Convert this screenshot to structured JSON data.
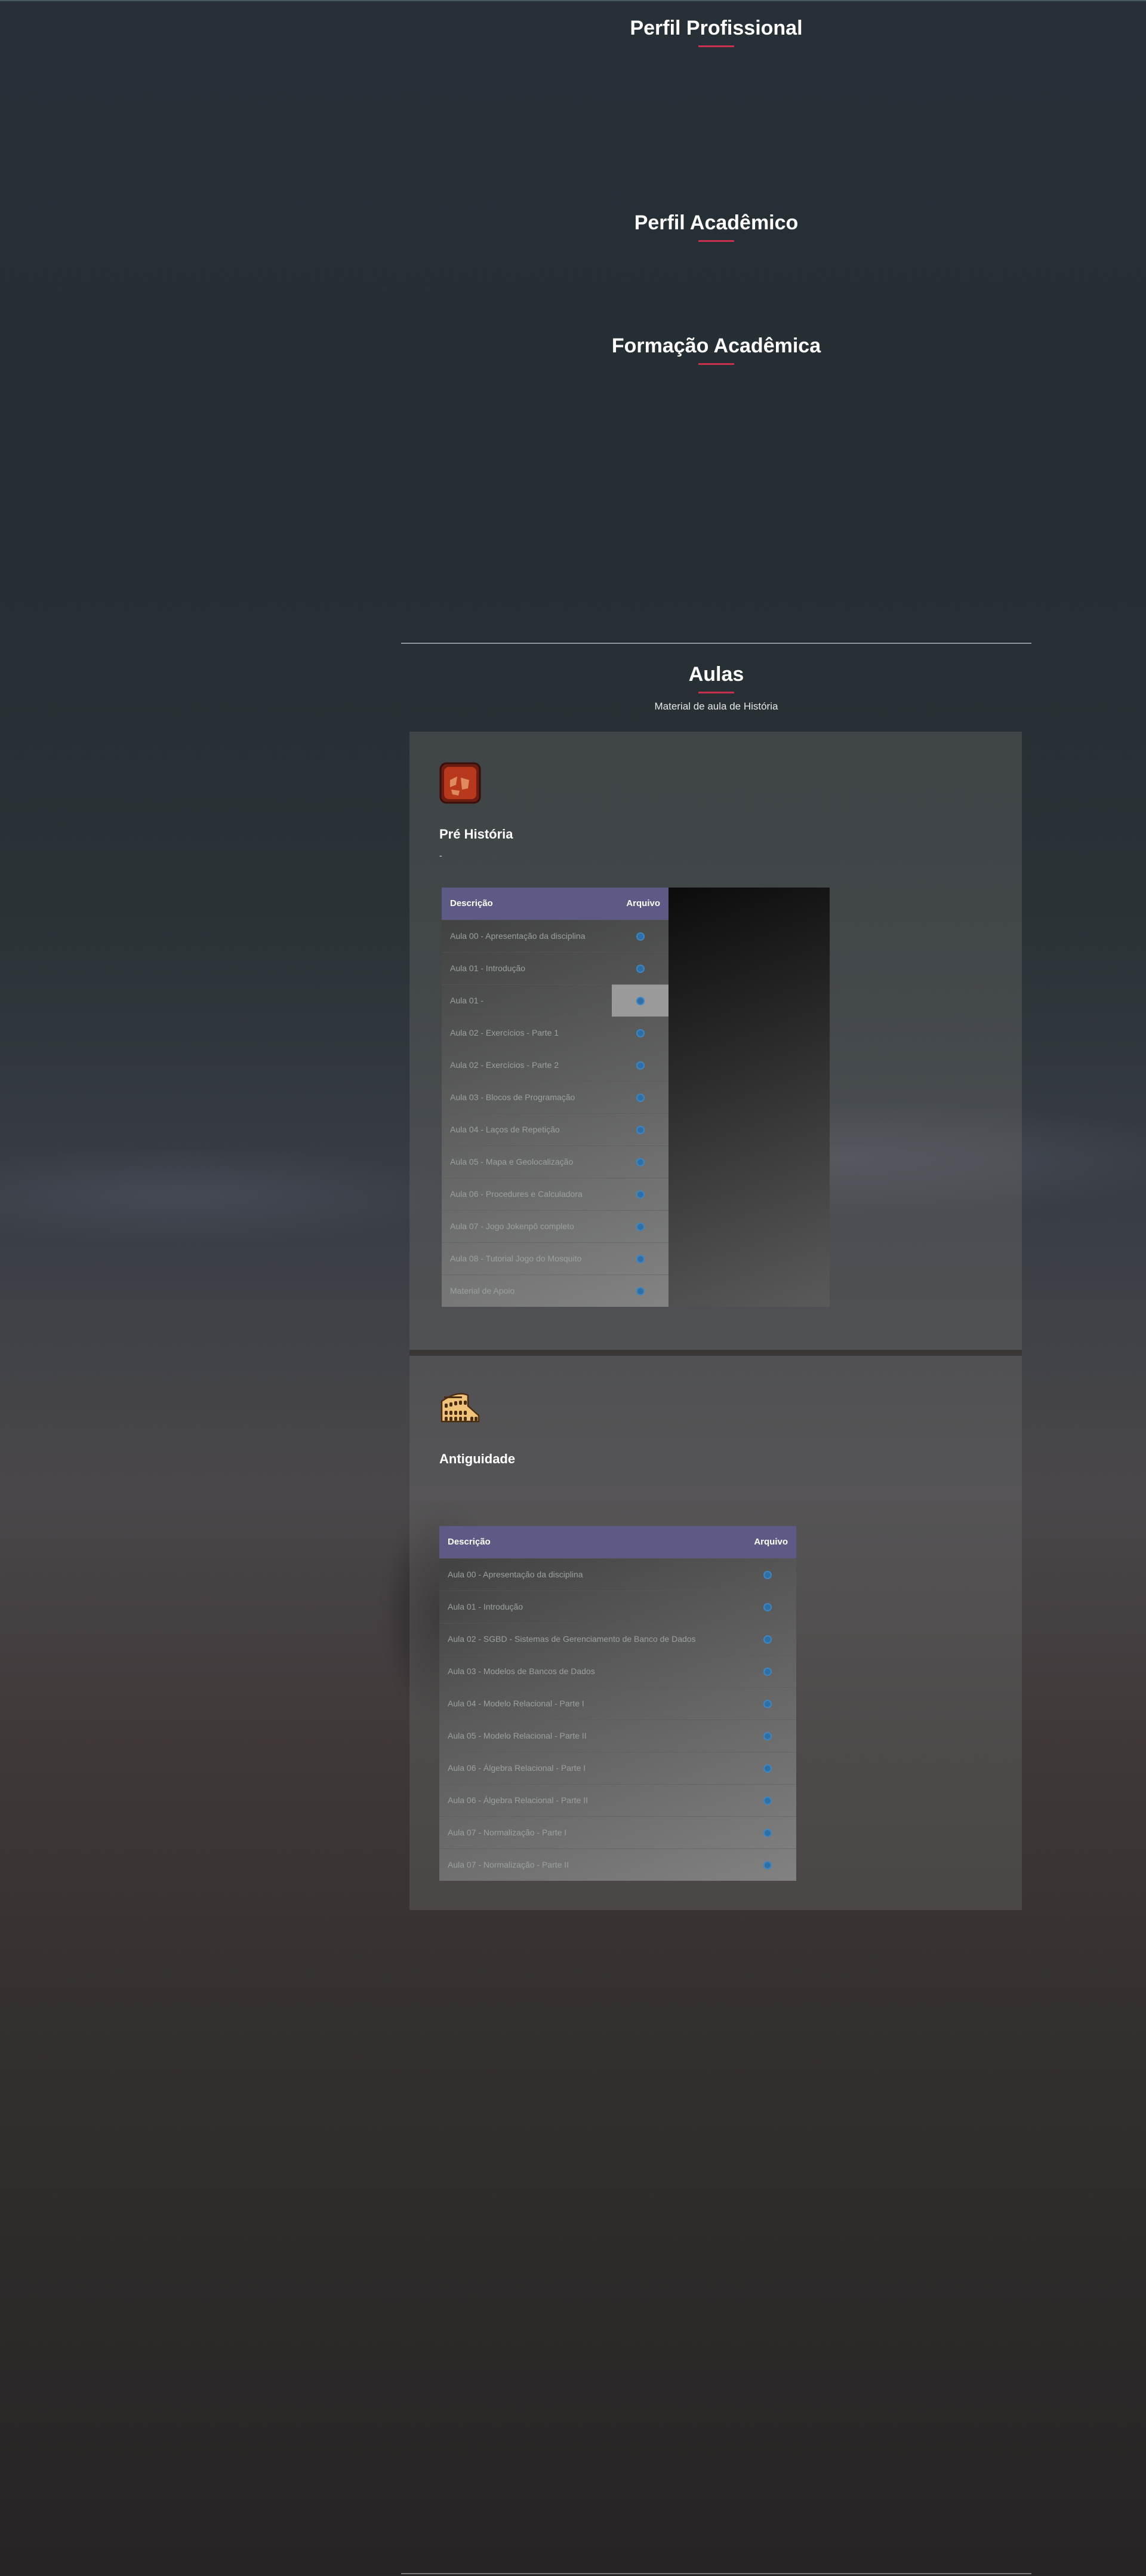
{
  "sections": {
    "profissional": "Perfil Profissional",
    "academico": "Perfil Acadêmico",
    "formacao": "Formação Acadêmica",
    "aulas": "Aulas",
    "aulas_subtitle": "Material de aula de História"
  },
  "cards": [
    {
      "title": "Pré História",
      "subtitle": "-",
      "icon": "amber-stone-icon",
      "headers": {
        "descricao": "Descrição",
        "arquivo": "Arquivo"
      },
      "rows": [
        "Aula 00 - Apresentação da disciplina",
        "Aula 01 - Introdução",
        "Aula 01 -",
        "Aula 02 - Exercícios - Parte 1",
        "Aula 02 - Exercícios - Parte 2",
        "Aula 03 - Blocos de Programação",
        "Aula 04 - Laços de Repetição",
        "Aula 05 - Mapa e Geolocalização",
        "Aula 06 - Procedures e Calculadora",
        "Aula 07 - Jogo Jokenpô completo",
        "Aula 08 - Tutorial Jogo do Mosquito",
        "Material de Apoio"
      ]
    },
    {
      "title": "Antiguidade",
      "subtitle": "",
      "icon": "colosseum-icon",
      "headers": {
        "descricao": "Descrição",
        "arquivo": "Arquivo"
      },
      "rows": [
        "Aula 00 - Apresentação da disciplina",
        "Aula 01 - Introdução",
        "Aula 02 - SGBD - Sistemas de Gerenciamento de Banco de Dados",
        "Aula 03 - Modelos de Bancos de Dados",
        "Aula 04 - Modelo Relacional - Parte I",
        "Aula 05 - Modelo Relacional - Parte II",
        "Aula 06 - Álgebra Relacional - Parte I",
        "Aula 06 - Álgebra Relacional - Parte II",
        "Aula 07 - Normalização - Parte I",
        "Aula 07 - Normalização - Parte II"
      ]
    }
  ]
}
